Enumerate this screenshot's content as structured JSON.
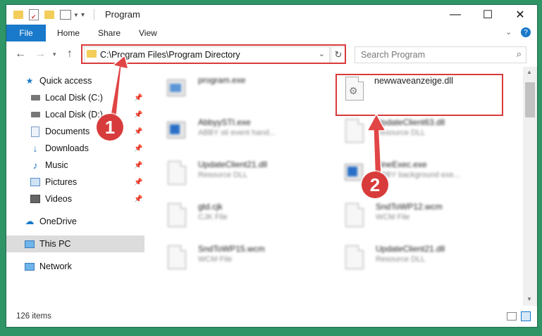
{
  "window": {
    "title": "Program"
  },
  "ribbon": {
    "file": "File",
    "tabs": [
      "Home",
      "Share",
      "View"
    ]
  },
  "address": {
    "path": "C:\\Program Files\\Program Directory",
    "search_placeholder": "Search Program"
  },
  "sidebar": {
    "quick_access": "Quick access",
    "items": [
      "Local Disk (C:)",
      "Local Disk (D:)",
      "Documents",
      "Downloads",
      "Music",
      "Pictures",
      "Videos"
    ],
    "onedrive": "OneDrive",
    "thispc": "This PC",
    "network": "Network"
  },
  "files": [
    {
      "name": "program.exe",
      "sub": ""
    },
    {
      "name": "newwaveanzeige.dll",
      "sub": ""
    },
    {
      "name": "AbbyySTI.exe",
      "sub": "ABBY sti event hand..."
    },
    {
      "name": "UpdateClient63.dll",
      "sub": "Resource DLL"
    },
    {
      "name": "UpdateClient21.dll",
      "sub": "Resource DLL"
    },
    {
      "name": "FineExec.exe",
      "sub": "ABBY background exe..."
    },
    {
      "name": "gtd.cjk",
      "sub": "CJK File"
    },
    {
      "name": "SndToWP12.wcm",
      "sub": "WCM File"
    },
    {
      "name": "SndToWP15.wcm",
      "sub": "WCM File"
    },
    {
      "name": "UpdateClient21.dll",
      "sub": "Resource DLL"
    }
  ],
  "status": {
    "count": "126 items"
  },
  "annotations": {
    "step1": "1",
    "step2": "2"
  },
  "colors": {
    "accent": "#1979ca",
    "highlight": "#d93a3a",
    "background": "#2f9466"
  }
}
